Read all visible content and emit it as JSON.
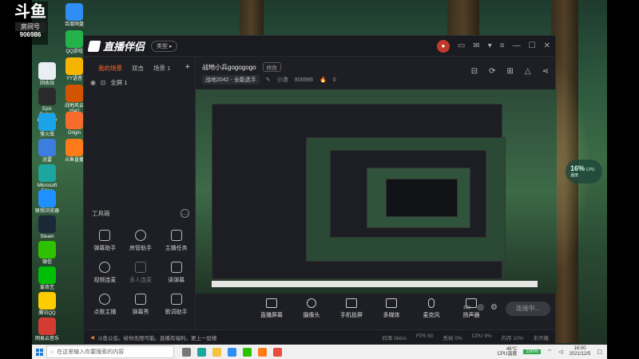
{
  "overlay": {
    "logo": "斗鱼",
    "room_label": "房间号",
    "room_number": "906986"
  },
  "desktop_icons": [
    {
      "label": "回收站",
      "color": "#e9eef4"
    },
    {
      "label": "Epic Games Launcher",
      "color": "#2a2a2a"
    },
    {
      "label": "萤火虫",
      "color": "#1aa3e8"
    },
    {
      "label": "迅雷",
      "color": "#3e7de0"
    },
    {
      "label": "Microsoft Edge",
      "color": "#1da6a0"
    },
    {
      "label": "联想浏览器",
      "color": "#1e90ff"
    },
    {
      "label": "Steam",
      "color": "#1b2838"
    },
    {
      "label": "微信",
      "color": "#2dc100"
    },
    {
      "label": "爱奇艺",
      "color": "#00be06"
    },
    {
      "label": "腾讯QQ",
      "color": "#ffcc00"
    },
    {
      "label": "网易云音乐",
      "color": "#d43c33"
    },
    {
      "label": "百度网盘",
      "color": "#2f8df3"
    },
    {
      "label": "QQ游戏",
      "color": "#24b24b"
    },
    {
      "label": "YY语音",
      "color": "#f5b400"
    },
    {
      "label": "战地风云 2042",
      "color": "#d35400"
    },
    {
      "label": "Origin",
      "color": "#f56c2d"
    },
    {
      "label": "斗鱼直播",
      "color": "#ff7b1a"
    }
  ],
  "app": {
    "brand": "直播伴侣",
    "type_pill": "类型 ▸",
    "tabs": [
      {
        "label": "我的场景",
        "active": true
      },
      {
        "label": "双击",
        "active": false
      },
      {
        "label": "场景 1",
        "active": false
      }
    ],
    "scene_item": "全屏 1",
    "tools_title": "工具箱",
    "tools": [
      {
        "label": "弹幕助手",
        "dim": false
      },
      {
        "label": "房管助手",
        "dim": false
      },
      {
        "label": "主播任务",
        "dim": false
      },
      {
        "label": "视频连麦",
        "dim": false
      },
      {
        "label": "多人连麦",
        "dim": true
      },
      {
        "label": "读弹幕",
        "dim": false
      },
      {
        "label": "点歌主播",
        "dim": false
      },
      {
        "label": "弹幕秀",
        "dim": false
      },
      {
        "label": "歌词助手",
        "dim": false
      }
    ],
    "room_title": "战地小兵gogogogo",
    "edit_label": "修改",
    "category": "战地2042 - 全能选手",
    "host_label": "小渣",
    "host_id": "906986",
    "heat": "0",
    "actions": [
      {
        "label": "直播屏幕"
      },
      {
        "label": "摄像头"
      },
      {
        "label": "手机投屏"
      },
      {
        "label": "多媒体"
      },
      {
        "label": "麦克风"
      },
      {
        "label": "扬声器"
      }
    ],
    "go_live": "连接中...",
    "notice": "斗鱼公会。给你无限可能。直播有福利。更上一层楼",
    "stats": {
      "bitrate": "码率 0kb/s",
      "fps": "FPS 60",
      "drop": "丢帧 0%",
      "cpu": "CPU 9%",
      "mem": "内存 10%",
      "status": "未开播"
    }
  },
  "cpu_widget": {
    "value": "16%",
    "label": "CPU温度"
  },
  "taskbar": {
    "search_placeholder": "在这里输入你要搜索的内容",
    "weather_temp": "46°C",
    "weather_label": "CPU温度",
    "time": "16:00",
    "date": "2021/12/5",
    "battery": "100%"
  }
}
